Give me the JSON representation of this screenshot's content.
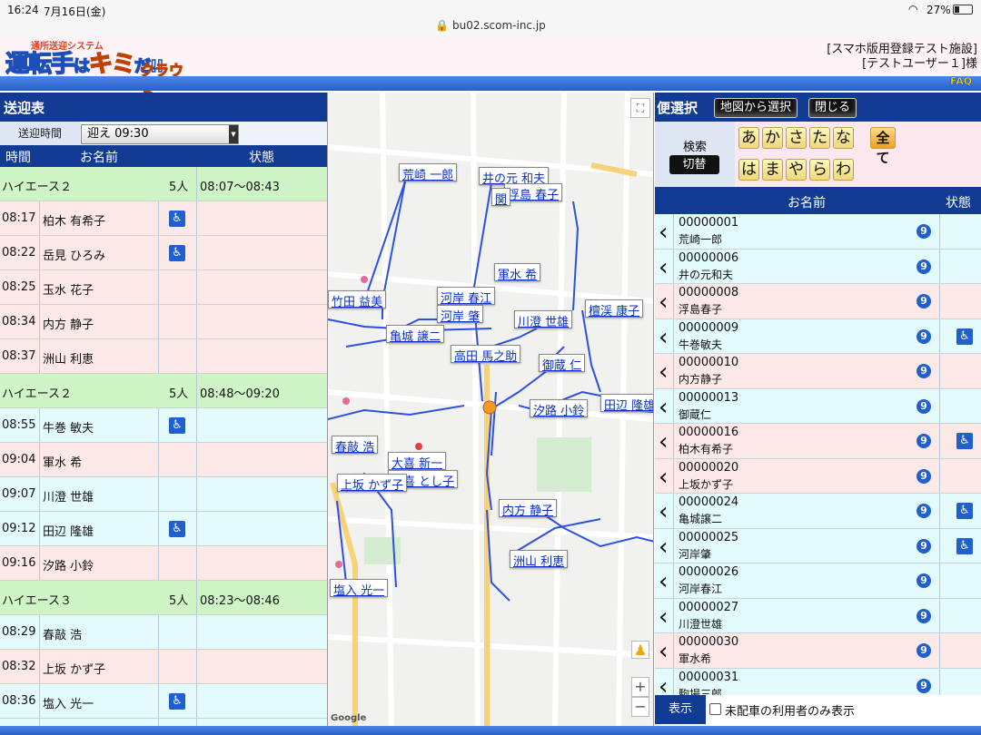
{
  "status": {
    "time": "16:24",
    "date": "7月16日(金)",
    "url": "bu02.scom-inc.jp",
    "battery": "27%"
  },
  "header": {
    "logo_sub": "通所送迎システム",
    "logo_main_a": "運転手",
    "logo_main_b": "は",
    "logo_main_c": "キミ",
    "logo_main_d": "だ!!",
    "logo_cloud": "クラウド",
    "facility": "[スマホ版用登録テスト施設]",
    "user": "[テストユーザー１]様",
    "faq": "FAQ"
  },
  "left": {
    "title": "送迎表",
    "time_label": "送迎時間",
    "time_value": "迎え 09:30",
    "cols": {
      "time": "時間",
      "name": "お名前",
      "state": "状態"
    },
    "rows": [
      {
        "type": "group",
        "c1": "ハイエース２",
        "c3": "5人",
        "c4": "08:07〜08:43"
      },
      {
        "type": "pink",
        "c1": "08:17",
        "c2": "柏木 有希子",
        "wc": true
      },
      {
        "type": "pink",
        "c1": "08:22",
        "c2": "岳見 ひろみ",
        "wc": true
      },
      {
        "type": "pink",
        "c1": "08:25",
        "c2": "玉水 花子"
      },
      {
        "type": "pink",
        "c1": "08:34",
        "c2": "内方 静子"
      },
      {
        "type": "pink",
        "c1": "08:37",
        "c2": "洲山 利恵"
      },
      {
        "type": "group",
        "c1": "ハイエース２",
        "c3": "5人",
        "c4": "08:48〜09:20"
      },
      {
        "type": "cyan",
        "c1": "08:55",
        "c2": "牛巻 敏夫",
        "wc": true
      },
      {
        "type": "pink",
        "c1": "09:04",
        "c2": "軍水 希"
      },
      {
        "type": "cyan",
        "c1": "09:07",
        "c2": "川澄 世雄"
      },
      {
        "type": "cyan",
        "c1": "09:12",
        "c2": "田辺 隆雄",
        "wc": true
      },
      {
        "type": "pink",
        "c1": "09:16",
        "c2": "汐路 小鈴"
      },
      {
        "type": "group",
        "c1": "ハイエース３",
        "c3": "5人",
        "c4": "08:23〜08:46"
      },
      {
        "type": "cyan",
        "c1": "08:29",
        "c2": "春敲 浩"
      },
      {
        "type": "pink",
        "c1": "08:32",
        "c2": "上坂 かず子"
      },
      {
        "type": "cyan",
        "c1": "08:36",
        "c2": "塩入 光一",
        "wc": true
      },
      {
        "type": "cyan",
        "c1": "",
        "c2": ""
      }
    ]
  },
  "map": {
    "markers": [
      "荒崎 一郎",
      "井の元 和夫",
      "浮島 春子",
      "関",
      "軍水 希",
      "竹田 益美",
      "河岸 春江",
      "河岸 肇",
      "川澄 世雄",
      "檀渓 康子",
      "亀城 譲二",
      "高田 馬之助",
      "御蔵 仁",
      "田辺 隆雄",
      "汐路 小鈴",
      "春敲 浩",
      "大喜 新一",
      "大喜 とし子",
      "上坂 かず子",
      "内方 静子",
      "洲山 利恵",
      "塩入 光一"
    ],
    "google": "Google",
    "zoom_in": "+",
    "zoom_out": "−",
    "fullscreen": "⛶"
  },
  "right": {
    "title": "便選択",
    "btn_map": "地図から選択",
    "btn_close": "閉じる",
    "search_label": "検索",
    "switch_label": "切替",
    "kana_row1": [
      "あ",
      "か",
      "さ",
      "た",
      "な",
      "全て"
    ],
    "kana_row2": [
      "は",
      "ま",
      "や",
      "ら",
      "わ"
    ],
    "cols": {
      "name": "お名前",
      "state": "状態"
    },
    "rows": [
      {
        "type": "cyan",
        "id": "00000001",
        "name": "荒崎一郎",
        "wc": false
      },
      {
        "type": "cyan",
        "id": "00000006",
        "name": "井の元和夫",
        "wc": false
      },
      {
        "type": "pink",
        "id": "00000008",
        "name": "浮島春子",
        "wc": false
      },
      {
        "type": "cyan",
        "id": "00000009",
        "name": "牛巻敏夫",
        "wc": true
      },
      {
        "type": "pink",
        "id": "00000010",
        "name": "内方静子",
        "wc": false
      },
      {
        "type": "cyan",
        "id": "00000013",
        "name": "御蔵仁",
        "wc": false
      },
      {
        "type": "pink",
        "id": "00000016",
        "name": "柏木有希子",
        "wc": true
      },
      {
        "type": "pink",
        "id": "00000020",
        "name": "上坂かず子",
        "wc": false
      },
      {
        "type": "cyan",
        "id": "00000024",
        "name": "亀城譲二",
        "wc": true
      },
      {
        "type": "cyan",
        "id": "00000025",
        "name": "河岸肇",
        "wc": true
      },
      {
        "type": "cyan",
        "id": "00000026",
        "name": "河岸春江",
        "wc": false
      },
      {
        "type": "cyan",
        "id": "00000027",
        "name": "川澄世雄",
        "wc": false
      },
      {
        "type": "pink",
        "id": "00000030",
        "name": "軍水希",
        "wc": false
      },
      {
        "type": "cyan",
        "id": "00000031",
        "name": "駒場三郎",
        "wc": false
      }
    ],
    "nine": "9",
    "foot_label": "表示",
    "foot_text": "未配車の利用者のみ表示"
  },
  "colors": {
    "navy": "#123c94",
    "group": "#cff5c6",
    "pink": "#fde8e8",
    "cyan": "#e4fbfd",
    "accent": "#1f5fd0"
  }
}
